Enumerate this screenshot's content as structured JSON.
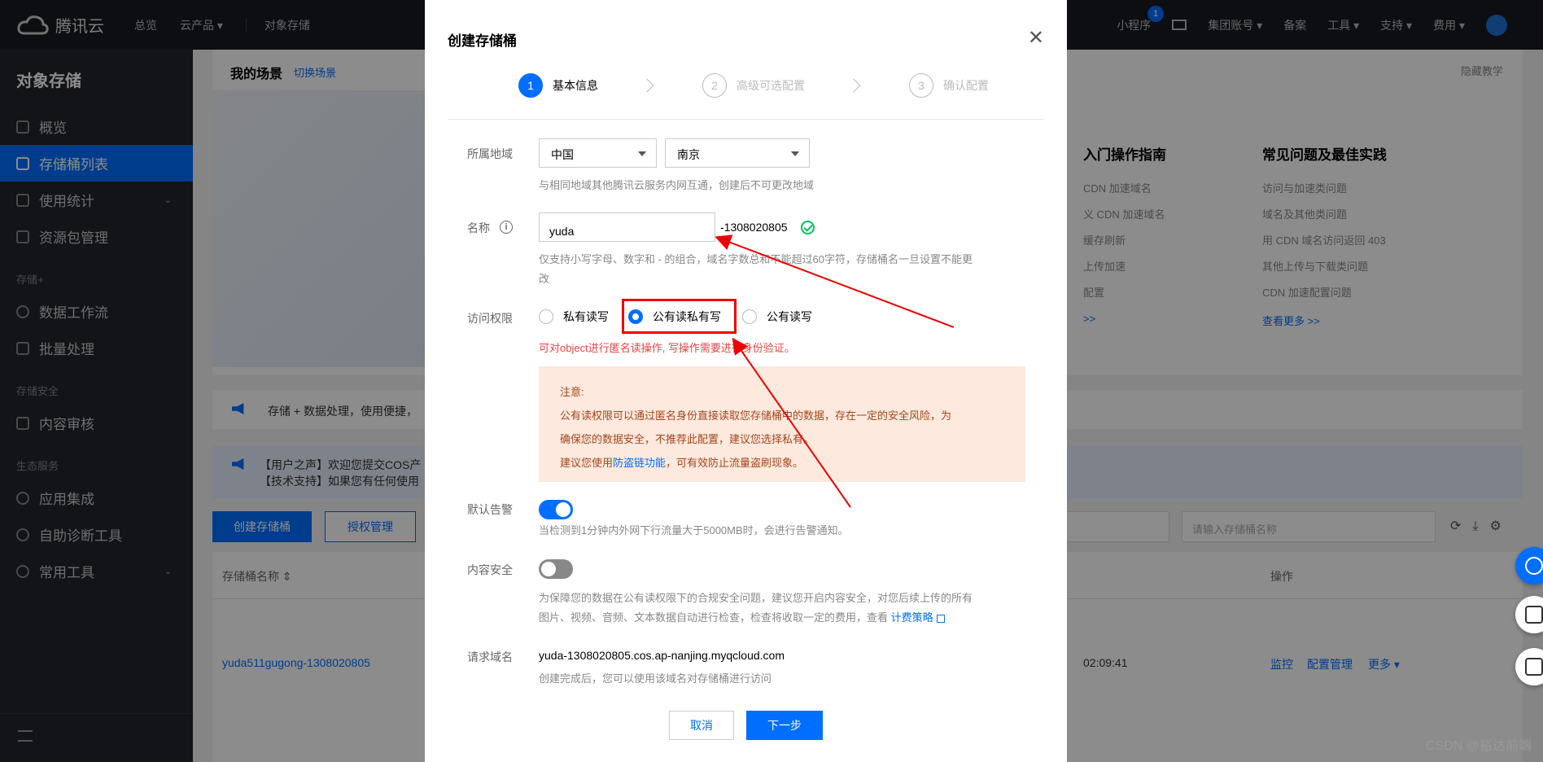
{
  "topbar": {
    "logo_text": "腾讯云",
    "nav": [
      "总览",
      "云产品 ▾",
      "对象存储"
    ],
    "right": [
      "小程序",
      "集团账号 ▾",
      "备案",
      "工具 ▾",
      "支持 ▾",
      "费用 ▾"
    ],
    "badge_count": "1"
  },
  "sidebar": {
    "title": "对象存储",
    "items": [
      {
        "label": "概览"
      },
      {
        "label": "存储桶列表"
      },
      {
        "label": "使用统计"
      },
      {
        "label": "资源包管理"
      }
    ],
    "group1": "存储+",
    "group1_items": [
      {
        "label": "数据工作流"
      },
      {
        "label": "批量处理"
      }
    ],
    "group2": "存储安全",
    "group2_items": [
      {
        "label": "内容审核"
      }
    ],
    "group3": "生态服务",
    "group3_items": [
      {
        "label": "应用集成"
      },
      {
        "label": "自助诊断工具"
      },
      {
        "label": "常用工具"
      }
    ]
  },
  "background": {
    "scene_title": "我的场景",
    "scene_switch": "切换场景",
    "hide_tip": "隐藏教学",
    "col1_heading": "入门操作指南",
    "col1_links": [
      "CDN 加速域名",
      "义 CDN 加速域名",
      "缓存刷新",
      "上传加速",
      "配置"
    ],
    "col1_more": ">>",
    "col2_heading": "常见问题及最佳实践",
    "col2_links": [
      "访问与加速类问题",
      "域名及其他类问题",
      "用 CDN 域名访问返回 403",
      "其他上传与下载类问题",
      "CDN 加速配置问题"
    ],
    "col2_more": "查看更多 >>",
    "notice1": "存储 + 数据处理，使用便捷，",
    "notice2_line1": "【用户之声】欢迎您提交COS产",
    "notice2_line2": "【技术支持】如果您有任何使用",
    "btn_create": "创建存储桶",
    "btn_auth": "授权管理",
    "search_placeholder": "请输入存储桶名称",
    "th_name": "存储桶名称 ⇕",
    "th_op": "操作",
    "row_name": "yuda511gugong-1308020805",
    "row_time": "02:09:41",
    "row_ops": [
      "监控",
      "配置管理",
      "更多 ▾"
    ]
  },
  "modal": {
    "title": "创建存储桶",
    "steps": [
      {
        "num": "1",
        "label": "基本信息"
      },
      {
        "num": "2",
        "label": "高级可选配置"
      },
      {
        "num": "3",
        "label": "确认配置"
      }
    ],
    "region_label": "所属地域",
    "region_country": "中国",
    "region_city": "南京",
    "region_hint": "与相同地域其他腾讯云服务内网互通，创建后不可更改地域",
    "name_label": "名称",
    "name_value": "yuda",
    "name_suffix": "-1308020805",
    "name_hint_1": "仅支持小写字母、数字和 - 的组合，域名字数总和不能超过60字符，存储桶名一旦设置不能更",
    "name_hint_2": "改",
    "access_label": "访问权限",
    "access_options": [
      "私有读写",
      "公有读私有写",
      "公有读写"
    ],
    "access_selected": "公有读私有写",
    "access_error": "可对object进行匿名读操作, 写操作需要进行身份验证。",
    "warn_title": "注意:",
    "warn_line1": "公有读权限可以通过匿名身份直接读取您存储桶中的数据，存在一定的安全风险，为",
    "warn_line2": "确保您的数据安全，不推荐此配置，建议您选择私有。",
    "warn_line3_pre": "建议您使用",
    "warn_line3_link": "防盗链功能",
    "warn_line3_post": "，可有效防止流量盗刷现象。",
    "alarm_label": "默认告警",
    "alarm_on": true,
    "alarm_hint": "当检测到1分钟内外网下行流量大于5000MB时，会进行告警通知。",
    "security_label": "内容安全",
    "security_on": false,
    "security_hint_1": "为保障您的数据在公有读权限下的合规安全问题，建议您开启内容安全，对您后续上传的所有",
    "security_hint_2": "图片、视频、音频、文本数据自动进行检查，检查将收取一定的费用，查看 ",
    "security_hint_link": "计费策略",
    "domain_label": "请求域名",
    "domain_value": "yuda-1308020805.cos.ap-nanjing.myqcloud.com",
    "domain_hint": "创建完成后，您可以使用该域名对存储桶进行访问",
    "cancel": "取消",
    "next": "下一步"
  },
  "watermark": "CSDN @裕达前端",
  "colors": {
    "accent": "#006eff",
    "error": "#e54545",
    "annotation": "#e00000"
  }
}
